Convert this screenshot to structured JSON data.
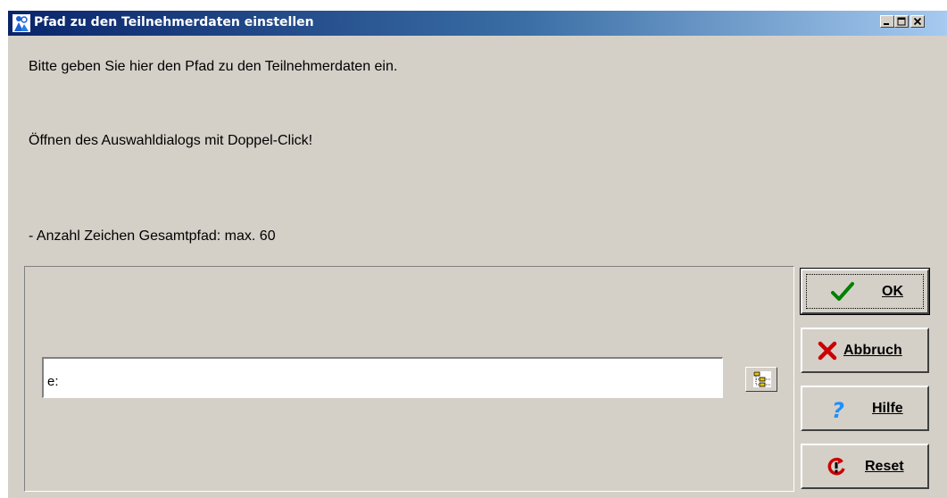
{
  "window": {
    "title": "Pfad zu den Teilnehmerdaten einstellen",
    "icon": "app-people-icon"
  },
  "titlebar_buttons": [
    "minimize-icon",
    "maximize-icon",
    "close-icon"
  ],
  "messages": {
    "line1": "Bitte geben Sie hier den Pfad zu den Teilnehmerdaten ein.",
    "line2": "Öffnen des Auswahldialogs mit Doppel-Click!",
    "line3": "- Anzahl Zeichen Gesamtpfad: max. 60"
  },
  "path_field": {
    "value": "e:",
    "browse_icon": "folder-tree-icon"
  },
  "buttons": {
    "ok": {
      "label": "OK",
      "icon": "checkmark-icon",
      "color": "#008000"
    },
    "cancel": {
      "label": "Abbruch",
      "icon": "x-icon",
      "color": "#cc0000"
    },
    "help": {
      "label": "Hilfe",
      "icon": "question-icon",
      "color": "#1e90ff"
    },
    "reset": {
      "label": "Reset",
      "icon": "reset-icon",
      "color": "#cc0000"
    }
  }
}
